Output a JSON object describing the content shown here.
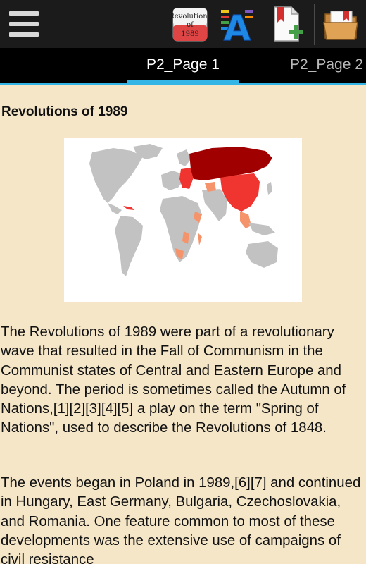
{
  "toolbar": {
    "revolutions_icon_text": [
      "Revolutions",
      "of",
      "1989"
    ],
    "font_icon_letter": "A"
  },
  "tabs": [
    {
      "label": "P2_Page 1",
      "active": true
    },
    {
      "label": "P2_Page 2",
      "active": false
    }
  ],
  "article": {
    "title": "Revolutions of 1989",
    "paragraphs": [
      "The Revolutions of 1989 were part of a revolutionary wave that resulted in the Fall of Communism in the Communist states of Central and Eastern Europe and beyond. The period is sometimes called the Autumn of Nations,[1][2][3][4][5] a play on the term \"Spring of Nations\", used to describe the Revolutions of 1848.",
      "The events began in Poland in 1989,[6][7] and continued in Hungary, East Germany, Bulgaria, Czechoslovakia, and Romania. One feature common to most of these developments was the extensive use of campaigns of civil resistance"
    ]
  },
  "colors": {
    "toolbar_bg": "#1b1b1b",
    "tabbar_bg": "#000000",
    "accent": "#33b5e5",
    "content_bg": "#f5e6c8",
    "map_land": "#c2c2c2",
    "map_ussr": "#a00000",
    "map_communist": "#f0342f",
    "map_socialist": "#f5936b"
  }
}
